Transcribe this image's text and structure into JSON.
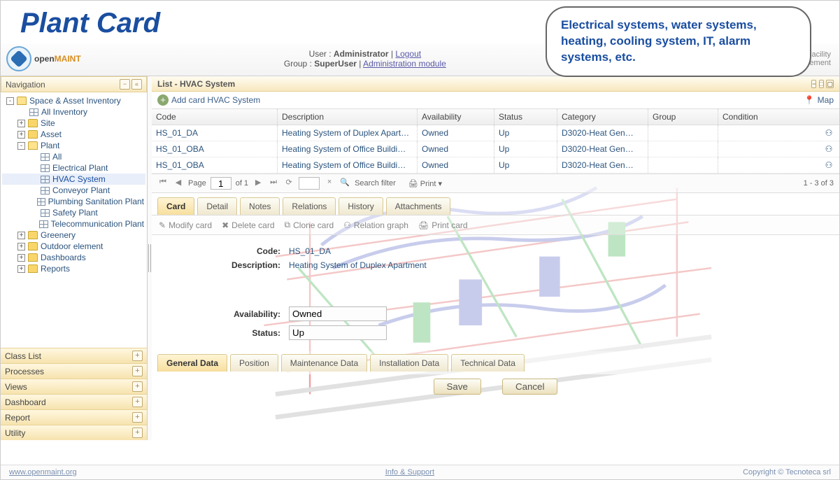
{
  "title": "Plant Card",
  "bubble_text": "Electrical systems, water systems, heating, cooling system, IT, alarm systems, etc.",
  "logo": {
    "brand1": "open",
    "brand2": "MAINT"
  },
  "user_block": {
    "user_label": "User :",
    "user_name": "Administrator",
    "logout": "Logout",
    "group_label": "Group :",
    "group_name": "SuperUser",
    "admin_link": "Administration module"
  },
  "tagline": "Open Source Solution for Property and Facility Management",
  "nav": {
    "header": "Navigation",
    "items": [
      {
        "label": "Space & Asset Inventory",
        "icon": "folder-open",
        "expand": "-",
        "indent": 0
      },
      {
        "label": "All Inventory",
        "icon": "grid",
        "expand": "",
        "indent": 1
      },
      {
        "label": "Site",
        "icon": "folder",
        "expand": "+",
        "indent": 1
      },
      {
        "label": "Asset",
        "icon": "folder",
        "expand": "+",
        "indent": 1
      },
      {
        "label": "Plant",
        "icon": "folder-open",
        "expand": "-",
        "indent": 1
      },
      {
        "label": "All",
        "icon": "grid",
        "expand": "",
        "indent": 2
      },
      {
        "label": "Electrical Plant",
        "icon": "grid",
        "expand": "",
        "indent": 2
      },
      {
        "label": "HVAC System",
        "icon": "grid",
        "expand": "",
        "indent": 2,
        "selected": true
      },
      {
        "label": "Conveyor Plant",
        "icon": "grid",
        "expand": "",
        "indent": 2
      },
      {
        "label": "Plumbing Sanitation Plant",
        "icon": "grid",
        "expand": "",
        "indent": 2
      },
      {
        "label": "Safety Plant",
        "icon": "grid",
        "expand": "",
        "indent": 2
      },
      {
        "label": "Telecommunication Plant",
        "icon": "grid",
        "expand": "",
        "indent": 2
      },
      {
        "label": "Greenery",
        "icon": "folder",
        "expand": "+",
        "indent": 1
      },
      {
        "label": "Outdoor element",
        "icon": "folder",
        "expand": "+",
        "indent": 1
      },
      {
        "label": "Dashboards",
        "icon": "folder",
        "expand": "+",
        "indent": 1
      },
      {
        "label": "Reports",
        "icon": "folder",
        "expand": "+",
        "indent": 1
      }
    ]
  },
  "accordion": [
    "Class List",
    "Processes",
    "Views",
    "Dashboard",
    "Report",
    "Utility"
  ],
  "list": {
    "title": "List - HVAC System",
    "add_label": "Add card HVAC System",
    "map_label": "Map",
    "columns": [
      "Code",
      "Description",
      "Availability",
      "Status",
      "Category",
      "Group",
      "Condition"
    ],
    "rows": [
      {
        "code": "HS_01_DA",
        "desc": "Heating System of Duplex Apart…",
        "avail": "Owned",
        "status": "Up",
        "cat": "D3020-Heat Gen…",
        "group": "",
        "cond": ""
      },
      {
        "code": "HS_01_OBA",
        "desc": "Heating System of Office Buildi…",
        "avail": "Owned",
        "status": "Up",
        "cat": "D3020-Heat Gen…",
        "group": "",
        "cond": ""
      },
      {
        "code": "HS_01_OBA",
        "desc": "Heating System of Office Buildi…",
        "avail": "Owned",
        "status": "Up",
        "cat": "D3020-Heat Gen…",
        "group": "",
        "cond": ""
      }
    ],
    "pager": {
      "page_label": "Page",
      "page": "1",
      "of_label": "of 1",
      "search_placeholder": "Search filter",
      "print": "Print",
      "count": "1 - 3 of 3"
    }
  },
  "card": {
    "tabs": [
      "Card",
      "Detail",
      "Notes",
      "Relations",
      "History",
      "Attachments"
    ],
    "active_tab": "Card",
    "actions": [
      "Modify card",
      "Delete card",
      "Clone card",
      "Relation graph",
      "Print card"
    ],
    "fields": {
      "code_label": "Code:",
      "code_value": "HS_01_DA",
      "desc_label": "Description:",
      "desc_value": "Heating System of Duplex Apartment",
      "avail_label": "Availability:",
      "avail_value": "Owned",
      "status_label": "Status:",
      "status_value": "Up"
    },
    "sub_tabs": [
      "General Data",
      "Position",
      "Maintenance Data",
      "Installation Data",
      "Technical Data"
    ],
    "active_sub": "General Data",
    "save": "Save",
    "cancel": "Cancel"
  },
  "footer": {
    "left": "www.openmaint.org",
    "center": "Info & Support",
    "right": "Copyright © Tecnoteca srl"
  }
}
